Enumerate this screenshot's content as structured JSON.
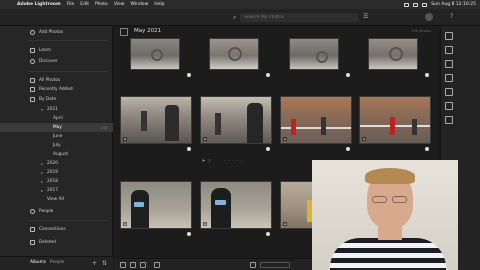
{
  "menubar": {
    "app_name": "Adobe Lightroom",
    "menus": [
      "File",
      "Edit",
      "Photo",
      "View",
      "Window",
      "Help"
    ],
    "clock": "Sun Aug 8  12:10:25"
  },
  "appbar": {
    "search_placeholder": "Search My Photos"
  },
  "sidebar": {
    "add_photos": "Add Photos",
    "learn": "Learn",
    "discover": "Discover",
    "all_photos": "All Photos",
    "all_photos_count": "",
    "recently_added": "Recently Added",
    "by_date": "By Date",
    "years": [
      {
        "label": "2021",
        "count": ""
      },
      {
        "label": "April",
        "count": ""
      },
      {
        "label": "May",
        "count": "158"
      },
      {
        "label": "June",
        "count": ""
      },
      {
        "label": "July",
        "count": ""
      },
      {
        "label": "August",
        "count": ""
      },
      {
        "label": "2020",
        "count": ""
      },
      {
        "label": "2019",
        "count": ""
      },
      {
        "label": "2018",
        "count": ""
      },
      {
        "label": "2017",
        "count": ""
      },
      {
        "label": "View All",
        "count": ""
      }
    ],
    "people": "People",
    "connections": "Connections",
    "deleted": "Deleted",
    "tab_albums": "Albums",
    "tab_people": "People"
  },
  "grid": {
    "title": "May 2021",
    "photos_count": "158 photos"
  },
  "colors": {
    "selected_row": "#3a3a3a",
    "panel_bg": "#262626",
    "grid_bg": "#1c1c1c"
  }
}
